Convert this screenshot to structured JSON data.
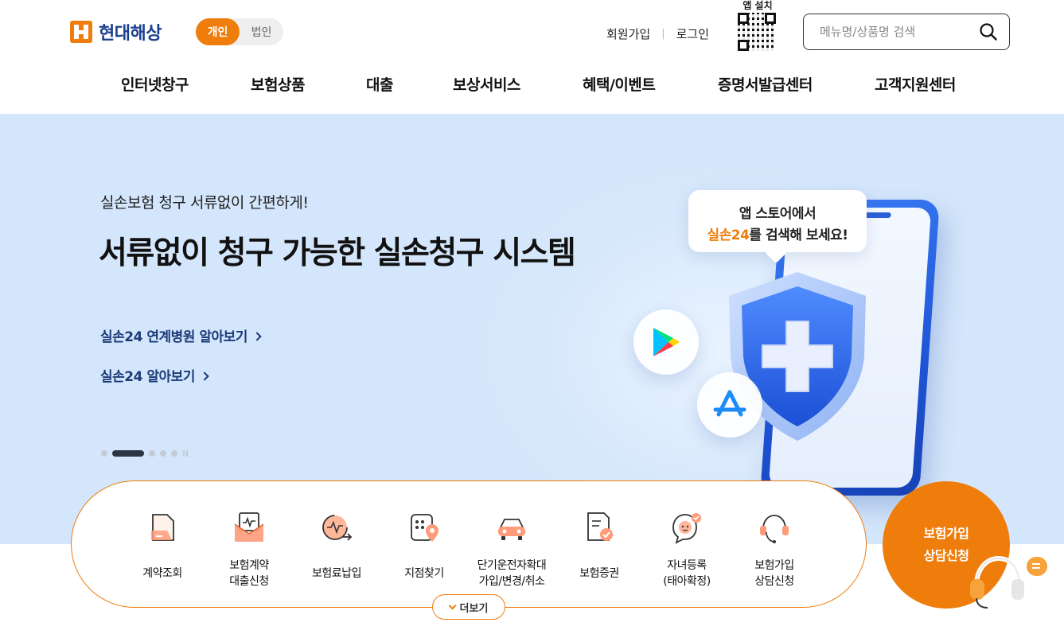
{
  "header": {
    "logo_text": "현대해상",
    "segment": [
      {
        "label": "개인",
        "active": true
      },
      {
        "label": "법인",
        "active": false
      }
    ],
    "util_links": {
      "signup": "회원가입",
      "login": "로그인"
    },
    "qr_label": "앱 설치",
    "search_placeholder": "메뉴명/상품명 검색"
  },
  "nav": [
    "인터넷창구",
    "보험상품",
    "대출",
    "보상서비스",
    "혜택/이벤트",
    "증명서발급센터",
    "고객지원센터"
  ],
  "hero": {
    "subtitle": "실손보험 청구 서류없이 간편하게!",
    "title": "서류없이 청구 가능한 실손청구 시스템",
    "links": [
      "실손24 연계병원 알아보기",
      "실손24 알아보기"
    ],
    "bubble_line1": "앱 스토어에서",
    "bubble_accent": "실손24",
    "bubble_rest": "를 검색해 보세요!",
    "slide_count": 5,
    "active_slide": 1
  },
  "quick_menu": {
    "items": [
      {
        "label": "계약조회",
        "icon": "contract-lookup-icon"
      },
      {
        "label": "보험계약\n대출신청",
        "icon": "loan-envelope-icon"
      },
      {
        "label": "보험료납입",
        "icon": "premium-payment-icon"
      },
      {
        "label": "지점찾기",
        "icon": "branch-locator-icon"
      },
      {
        "label": "단기운전자확대\n가입/변경/취소",
        "icon": "car-icon"
      },
      {
        "label": "보험증권",
        "icon": "policy-document-icon"
      },
      {
        "label": "자녀등록\n(태아확정)",
        "icon": "child-registration-icon"
      },
      {
        "label": "보험가입\n상담신청",
        "icon": "consult-headset-icon"
      }
    ],
    "more_label": "더보기"
  },
  "consult": {
    "line1": "보험가입",
    "line2": "상담신청"
  },
  "colors": {
    "accent": "#ef7d0b",
    "brand_navy": "#1b3f8f",
    "hero_bg": "#d4e6fb"
  }
}
